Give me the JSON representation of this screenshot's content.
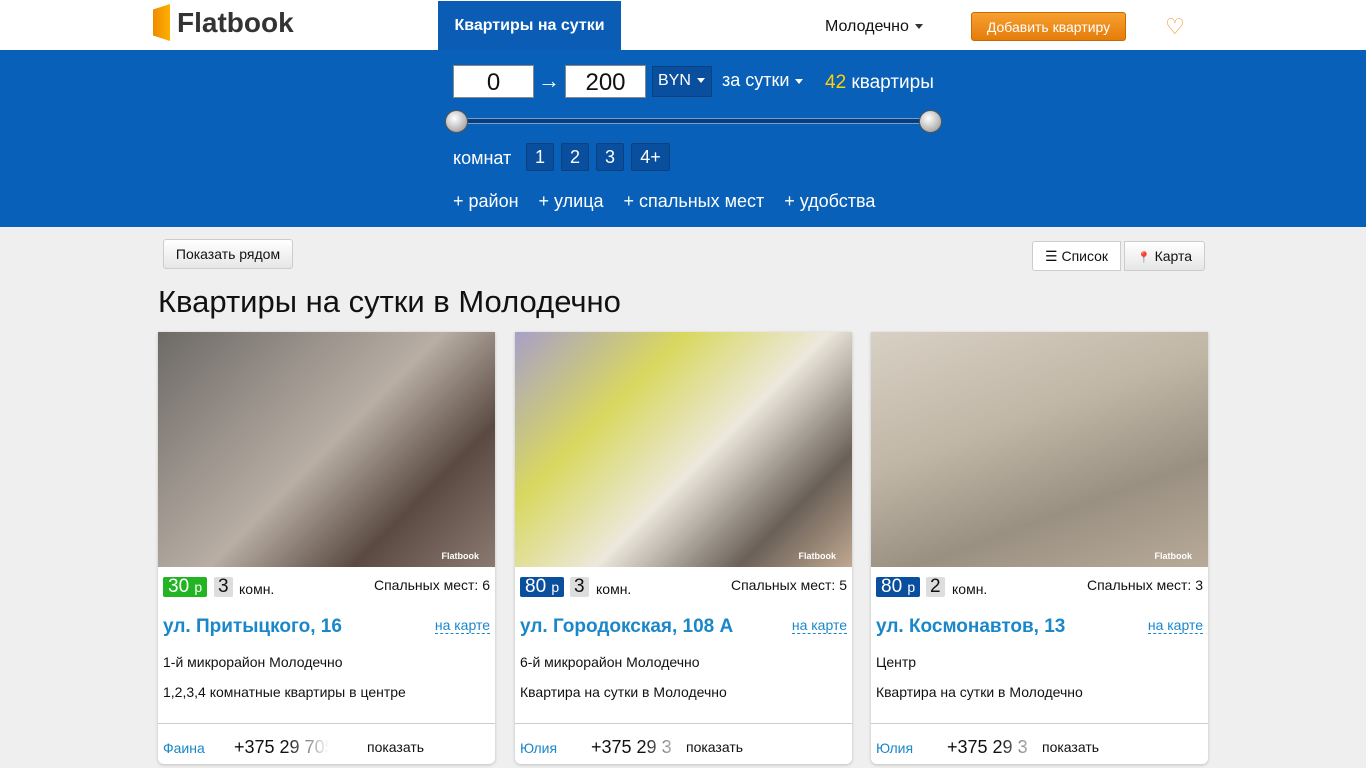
{
  "header": {
    "logo": "Flatbook",
    "nav_tab": "Квартиры на сутки",
    "city": "Молодечно",
    "add_button": "Добавить квартиру"
  },
  "filter": {
    "price_min": "0",
    "price_max": "200",
    "currency": "BYN",
    "period": "за сутки",
    "count": "42",
    "count_label": "квартиры",
    "rooms_label": "комнат",
    "rooms": [
      "1",
      "2",
      "3",
      "4+"
    ],
    "links": [
      "+ район",
      "+ улица",
      "+ спальных мест",
      "+ удобства"
    ]
  },
  "toolbar": {
    "near": "Показать рядом",
    "list": "Список",
    "map": "Карта"
  },
  "title": "Квартиры на сутки в Молодечно",
  "cards": [
    {
      "price": "30",
      "price_unit": "р",
      "price_color": "#22b422",
      "rooms": "3",
      "rooms_label": "комн.",
      "beds": "Спальных мест: 6",
      "address": "ул. Притыцкого, 16",
      "map_link": "на карте",
      "district": "1-й микрорайон Молодечно",
      "desc": "1,2,3,4 комнатные квартиры в центре",
      "owner": "Фаина",
      "phone": "+375 29 705",
      "show": "показать",
      "watermark": "Flatbook"
    },
    {
      "price": "80",
      "price_unit": "р",
      "price_color": "#0a4f9e",
      "rooms": "3",
      "rooms_label": "комн.",
      "beds": "Спальных мест: 5",
      "address": "ул. Городокская, 108 А",
      "map_link": "на карте",
      "district": "6-й микрорайон Молодечно",
      "desc": "Квартира на сутки в Молодечно",
      "owner": "Юлия",
      "phone": "+375 29 3",
      "show": "показать",
      "watermark": "Flatbook"
    },
    {
      "price": "80",
      "price_unit": "р",
      "price_color": "#0a4f9e",
      "rooms": "2",
      "rooms_label": "комн.",
      "beds": "Спальных мест: 3",
      "address": "ул. Космонавтов, 13",
      "map_link": "на карте",
      "district": "Центр",
      "desc": "Квартира на сутки в Молодечно",
      "owner": "Юлия",
      "phone": "+375 29 3",
      "show": "показать",
      "watermark": "Flatbook"
    }
  ]
}
